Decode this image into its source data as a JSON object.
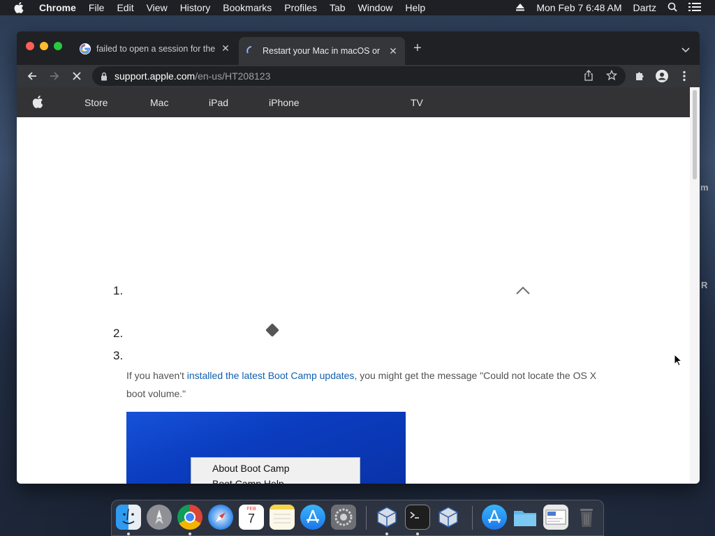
{
  "menubar": {
    "app_name": "Chrome",
    "items": [
      "File",
      "Edit",
      "View",
      "History",
      "Bookmarks",
      "Profiles",
      "Tab",
      "Window",
      "Help"
    ],
    "datetime": "Mon Feb 7  6:48 AM",
    "user": "Dartz"
  },
  "tabs": [
    {
      "title": "failed to open a session for the",
      "active": false,
      "favicon": "google-icon"
    },
    {
      "title": "Restart your Mac in macOS or",
      "active": true,
      "favicon": "loading-spinner-icon"
    }
  ],
  "address_bar": {
    "host": "support.apple.com",
    "path": "/en-us/HT208123"
  },
  "apple_nav": {
    "items": [
      "Store",
      "Mac",
      "iPad",
      "iPhone",
      "TV"
    ]
  },
  "content": {
    "steps": [
      "1.",
      "2.",
      "3."
    ],
    "paragraph_before": "If you haven't ",
    "link_text": "installed the latest Boot Camp updates",
    "paragraph_after": ", you might get the message \"Could not locate the OS X boot volume.\"",
    "context_menu_items": [
      "About Boot Camp",
      "Boot Camp Help"
    ]
  },
  "desktop_side": {
    "text_1": "m",
    "text_2": "R"
  },
  "dock": {
    "apps": [
      "finder-icon",
      "launchpad-icon",
      "chrome-icon",
      "safari-icon",
      "calendar-icon",
      "notes-icon",
      "app-store-icon",
      "system-preferences-icon",
      "virtualbox-icon",
      "terminal-icon",
      "virtualbox-icon",
      "app-store-download-icon",
      "folder-icon",
      "screenshot-icon",
      "trash-icon"
    ],
    "calendar_month": "FEB",
    "calendar_day": "7"
  }
}
